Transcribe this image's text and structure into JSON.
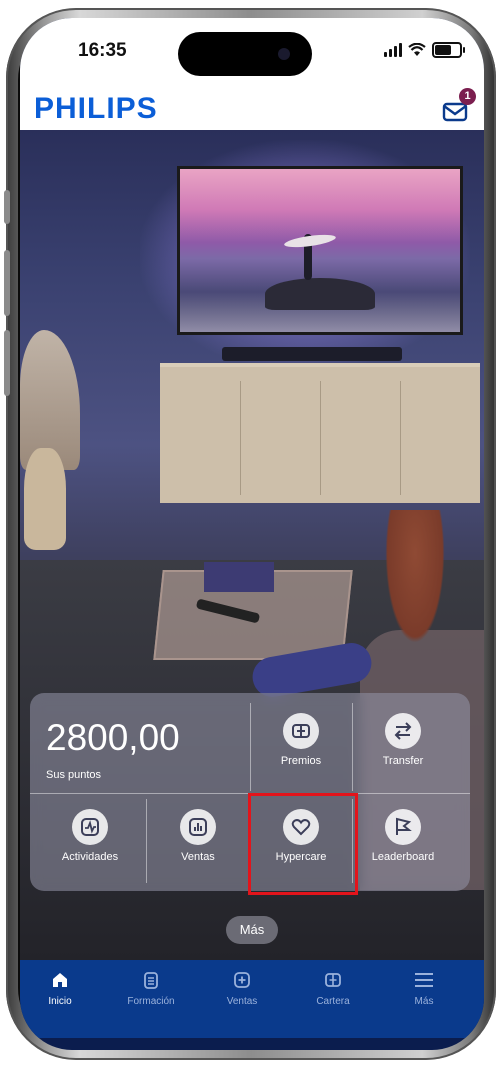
{
  "status_bar": {
    "time": "16:35"
  },
  "header": {
    "logo": "PHILIPS",
    "inbox_badge": "1"
  },
  "points": {
    "value": "2800,00",
    "label": "Sus puntos"
  },
  "actions": [
    {
      "label": "Premios",
      "icon": "gift-icon"
    },
    {
      "label": "Transfer",
      "icon": "transfer-icon"
    },
    {
      "label": "Actividades",
      "icon": "activity-icon"
    },
    {
      "label": "Ventas",
      "icon": "chart-icon"
    },
    {
      "label": "Hypercare",
      "icon": "heart-icon",
      "highlighted": true
    },
    {
      "label": "Leaderboard",
      "icon": "flag-icon"
    }
  ],
  "more_button": "Más",
  "nav": [
    {
      "label": "Inicio",
      "icon": "home-icon",
      "active": true
    },
    {
      "label": "Formación",
      "icon": "document-icon"
    },
    {
      "label": "Ventas",
      "icon": "plus-icon"
    },
    {
      "label": "Cartera",
      "icon": "wallet-icon"
    },
    {
      "label": "Más",
      "icon": "menu-icon"
    }
  ],
  "colors": {
    "brand": "#0b5ed7",
    "nav_bg": "#0a3a8c",
    "badge": "#7b1e4f",
    "highlight": "#e3141b"
  }
}
